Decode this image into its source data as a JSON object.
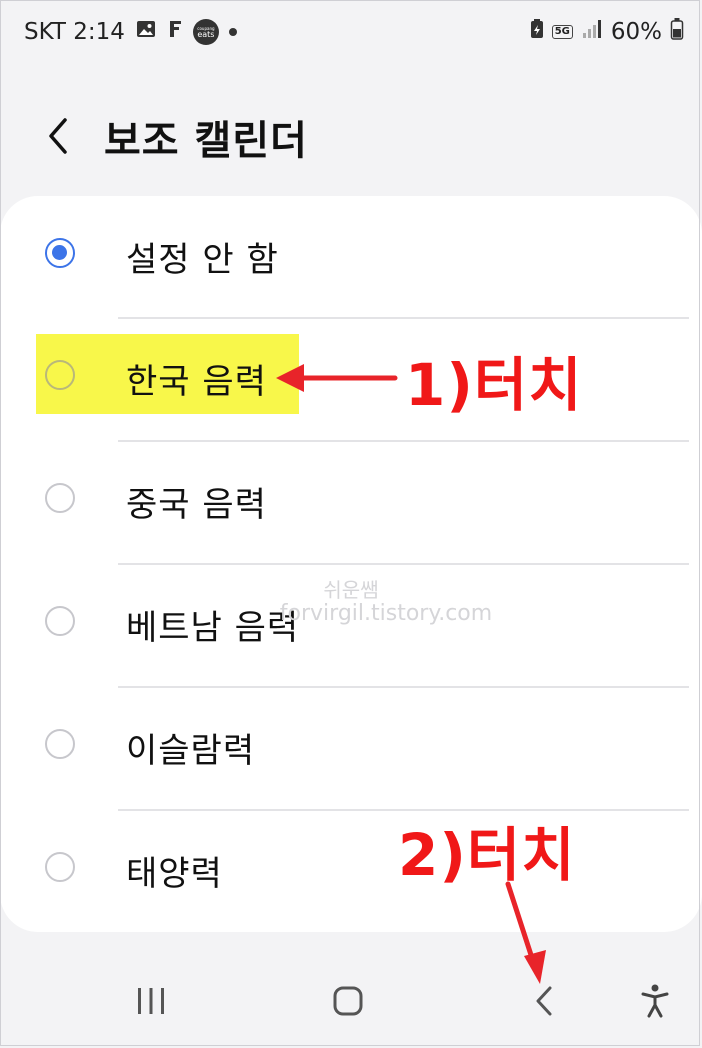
{
  "status_bar": {
    "carrier_time": "SKT 2:14",
    "network": "5G",
    "battery": "60%",
    "icons": [
      "image-icon",
      "f-app-icon",
      "coupang-eats-icon",
      "notification-dot-icon",
      "battery-saver-icon",
      "signal-icon",
      "battery-icon"
    ],
    "eats_text_top": "coupang",
    "eats_text": "eats"
  },
  "header": {
    "title": "보조 캘린더",
    "back_icon": "back-chevron-icon"
  },
  "options": [
    {
      "label": "설정 안 함",
      "selected": true
    },
    {
      "label": "한국 음력",
      "selected": false,
      "highlighted": true
    },
    {
      "label": "중국 음력",
      "selected": false
    },
    {
      "label": "베트남 음력",
      "selected": false
    },
    {
      "label": "이슬람력",
      "selected": false
    },
    {
      "label": "태양력",
      "selected": false
    }
  ],
  "annotations": {
    "step1": "1)터치",
    "step2": "2)터치",
    "color": "#f01818"
  },
  "watermark": {
    "line1": "쉬운쌤",
    "line2": "forvirgil.tistory.com"
  },
  "nav_bar": {
    "recents_icon": "recents-icon",
    "home_icon": "home-icon",
    "back_icon": "back-icon",
    "accessibility_icon": "accessibility-icon"
  },
  "colors": {
    "accent": "#3c74e8",
    "highlight": "#f8f74a",
    "background": "#f3f3f5"
  }
}
